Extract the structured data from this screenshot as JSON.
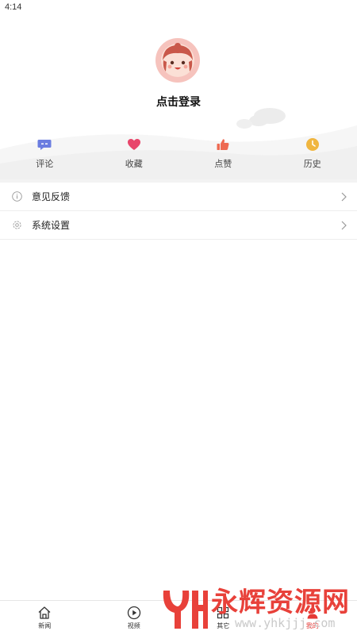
{
  "status_bar": {
    "time": "4:14"
  },
  "profile": {
    "avatar_icon": "cartoon-girl-avatar",
    "login_text": "点击登录"
  },
  "quick_actions": [
    {
      "label": "评论",
      "icon": "comment-icon",
      "color": "#6b7de0"
    },
    {
      "label": "收藏",
      "icon": "heart-icon",
      "color": "#e8466b"
    },
    {
      "label": "点赞",
      "icon": "thumbs-up-icon",
      "color": "#ee6a52"
    },
    {
      "label": "历史",
      "icon": "clock-icon",
      "color": "#f0b640"
    }
  ],
  "menu": [
    {
      "label": "意见反馈",
      "icon": "info-icon"
    },
    {
      "label": "系统设置",
      "icon": "gear-icon"
    }
  ],
  "bottom_nav": [
    {
      "label": "新闻",
      "icon": "home-icon"
    },
    {
      "label": "视频",
      "icon": "play-icon"
    },
    {
      "label": "其它",
      "icon": "grid-icon"
    },
    {
      "label": "我的",
      "icon": "user-icon",
      "active": true
    }
  ],
  "watermark": {
    "text": "永辉资源网",
    "url": "www.yhkjjj.com",
    "logo": "yh-logo"
  },
  "colors": {
    "accent": "#e53935",
    "divider": "#f3f3f3"
  }
}
